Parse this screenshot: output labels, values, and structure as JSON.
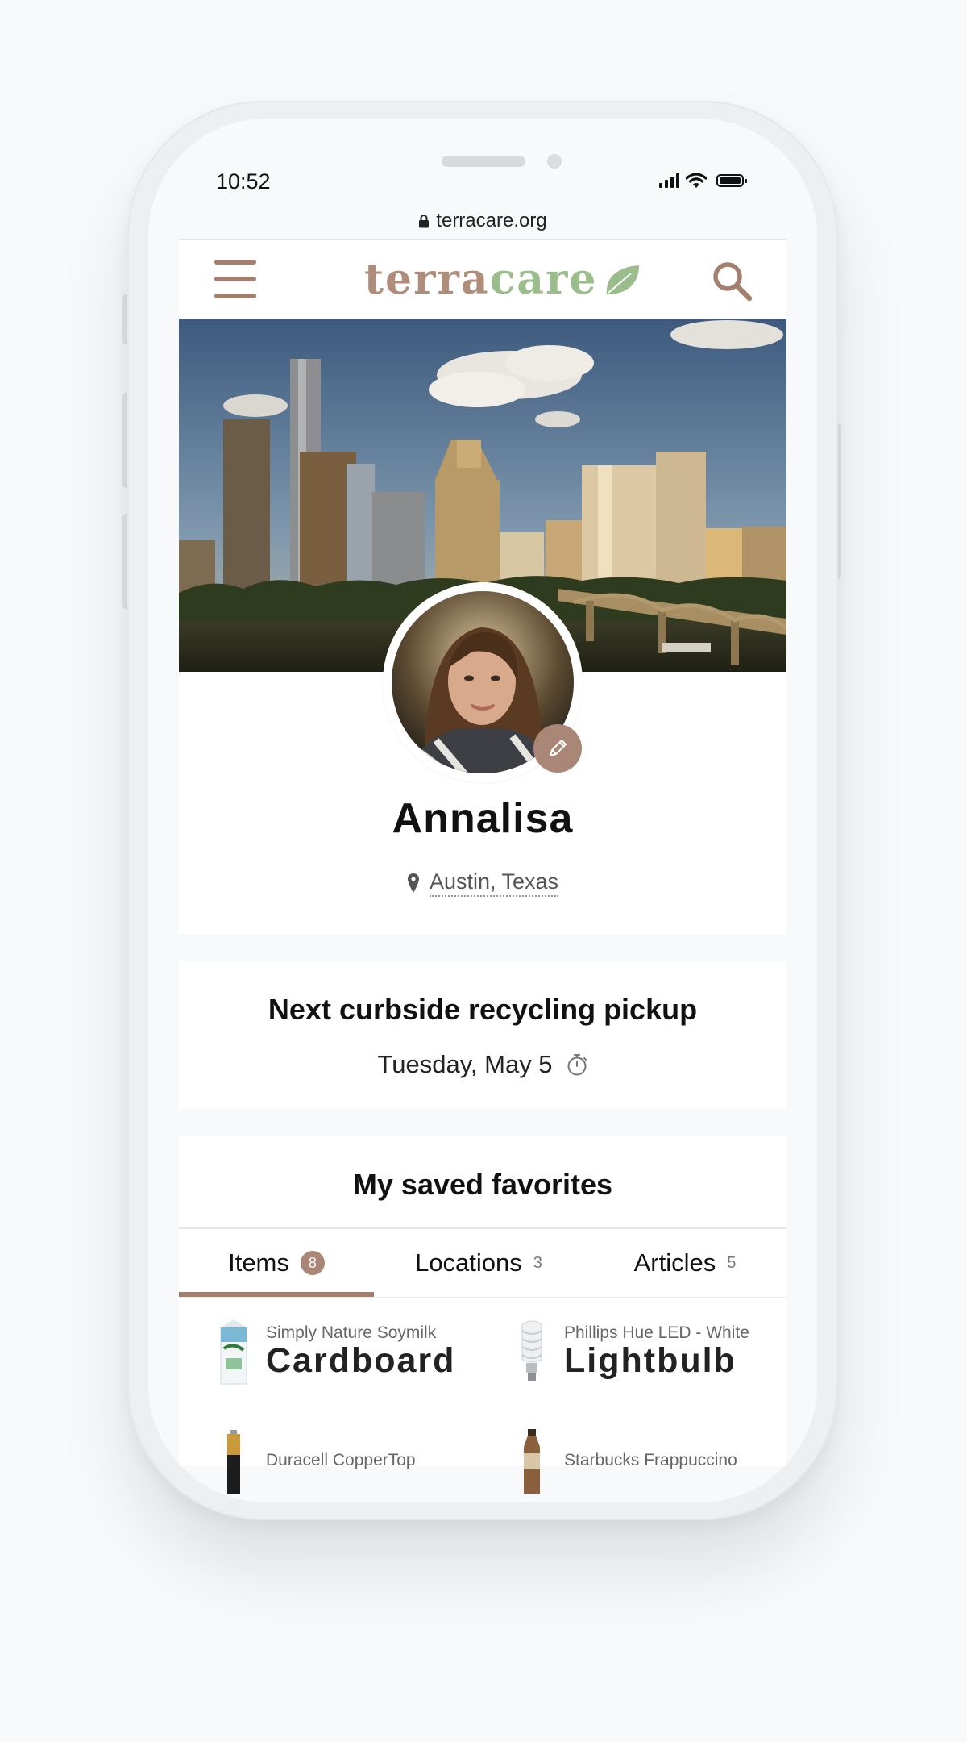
{
  "status_bar": {
    "time": "10:52"
  },
  "browser": {
    "url": "terracare.org"
  },
  "header": {
    "logo_part1": "terra",
    "logo_part2": "care"
  },
  "profile": {
    "name": "Annalisa",
    "location": "Austin, Texas"
  },
  "pickup": {
    "title": "Next curbside recycling pickup",
    "date": "Tuesday, May 5"
  },
  "favorites": {
    "title": "My saved favorites",
    "tabs": [
      {
        "label": "Items",
        "count": "8"
      },
      {
        "label": "Locations",
        "count": "3"
      },
      {
        "label": "Articles",
        "count": "5"
      }
    ],
    "items": [
      {
        "name": "Simply Nature Soymilk",
        "category": "Cardboard"
      },
      {
        "name": "Phillips Hue LED - White",
        "category": "Lightbulb"
      },
      {
        "name": "Duracell CopperTop",
        "category": ""
      },
      {
        "name": "Starbucks Frappuccino",
        "category": ""
      }
    ]
  },
  "colors": {
    "accent": "#a57f6d",
    "leaf_green": "#9bbd8c",
    "background": "#f8f9fa"
  }
}
